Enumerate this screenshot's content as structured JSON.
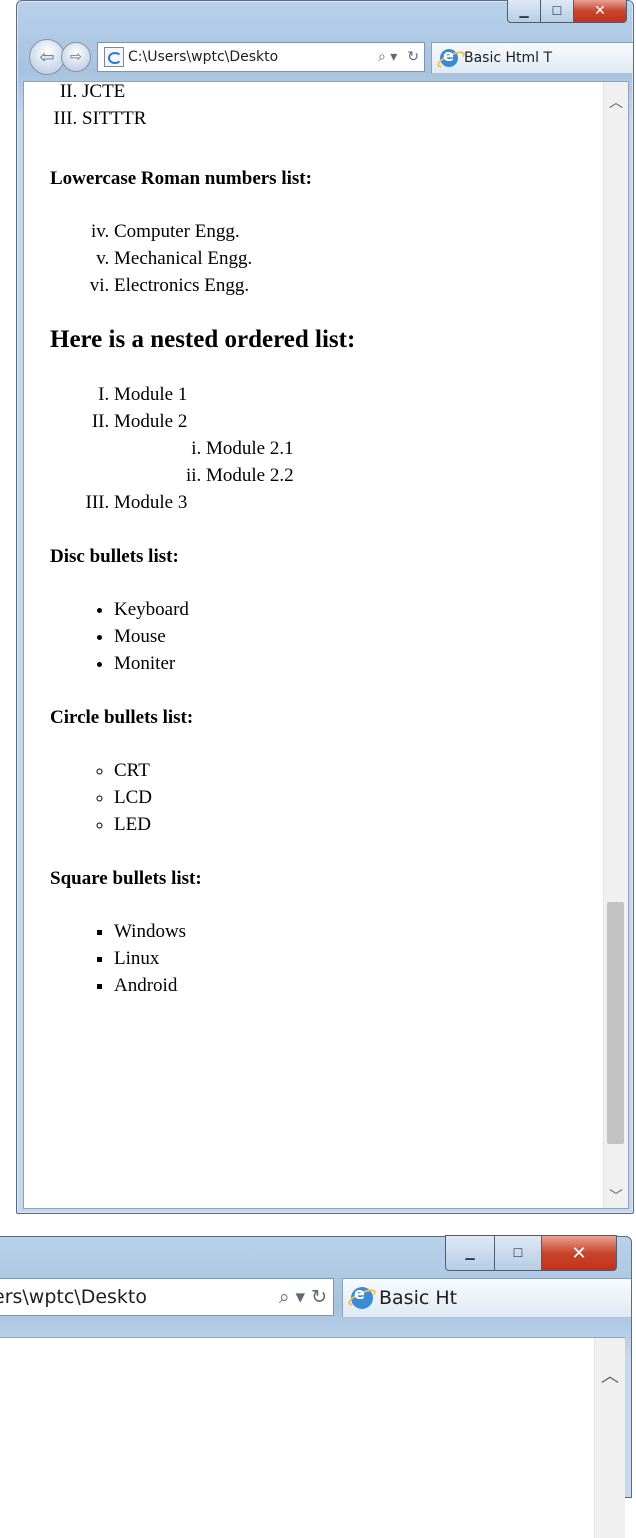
{
  "window": {
    "controls": {
      "minimize": "▁",
      "maximize": "☐",
      "close": "✕"
    },
    "nav": {
      "back": "⇦",
      "forward": "⇨"
    },
    "address": {
      "url": "C:\\Users\\wptc\\Deskto",
      "search_icon": "⌕ ▾",
      "refresh_icon": "↻"
    },
    "tab": {
      "title": "Basic Html T"
    }
  },
  "document": {
    "upper_roman_tail": [
      "JCTE",
      "SITTTR"
    ],
    "lower_roman_heading": "Lowercase Roman numbers list:",
    "lower_roman_items": [
      "Computer Engg.",
      "Mechanical Engg.",
      "Electronics Engg."
    ],
    "nested_heading": "Here is a nested ordered list:",
    "nested": {
      "module1": "Module 1",
      "module2": "Module 2",
      "module2_children": [
        "Module 2.1",
        "Module 2.2"
      ],
      "module3": "Module 3"
    },
    "disc_heading": "Disc bullets list:",
    "disc_items": [
      "Keyboard",
      "Mouse",
      "Moniter"
    ],
    "circle_heading": "Circle bullets list:",
    "circle_items": [
      "CRT",
      "LCD",
      "LED"
    ],
    "square_heading": "Square bullets list:",
    "square_items": [
      "Windows",
      "Linux",
      "Android"
    ]
  },
  "window2": {
    "address": {
      "url": "ers\\wptc\\Deskto",
      "controls": "⌕ ▾  ↻"
    },
    "tab": {
      "title": "Basic Ht"
    }
  }
}
